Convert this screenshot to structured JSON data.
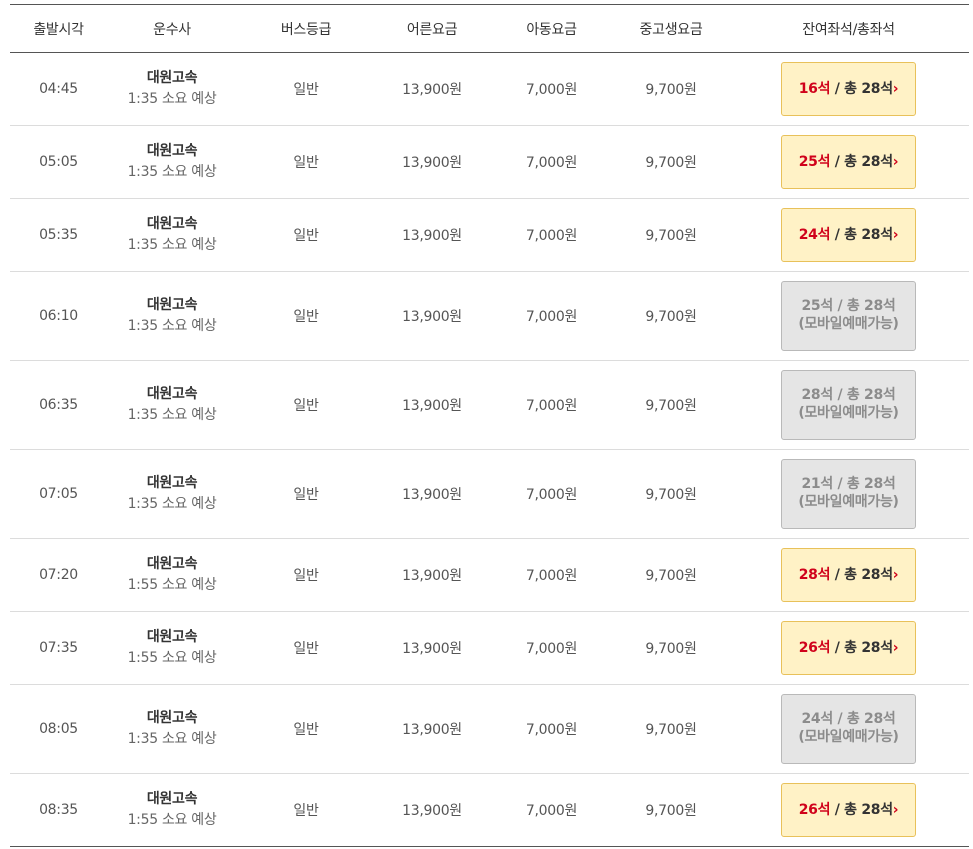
{
  "headers": [
    "출발시각",
    "운수사",
    "버스등급",
    "어른요금",
    "아동요금",
    "중고생요금",
    "잔여좌석/총좌석"
  ],
  "rows": [
    {
      "time": "04:45",
      "company": "대원고속",
      "duration": "1:35 소요 예상",
      "grade": "일반",
      "adult": "13,900원",
      "child": "7,000원",
      "student": "9,700원",
      "remaining": "16석",
      "total": " / 총 28석",
      "status": "available",
      "arrow": "›"
    },
    {
      "time": "05:05",
      "company": "대원고속",
      "duration": "1:35 소요 예상",
      "grade": "일반",
      "adult": "13,900원",
      "child": "7,000원",
      "student": "9,700원",
      "remaining": "25석",
      "total": " / 총 28석",
      "status": "available",
      "arrow": "›"
    },
    {
      "time": "05:35",
      "company": "대원고속",
      "duration": "1:35 소요 예상",
      "grade": "일반",
      "adult": "13,900원",
      "child": "7,000원",
      "student": "9,700원",
      "remaining": "24석",
      "total": " / 총 28석",
      "status": "available",
      "arrow": "›"
    },
    {
      "time": "06:10",
      "company": "대원고속",
      "duration": "1:35 소요 예상",
      "grade": "일반",
      "adult": "13,900원",
      "child": "7,000원",
      "student": "9,700원",
      "remaining": "25석",
      "total": " / 총 28석",
      "status": "mobile",
      "note": "(모바일예매가능)"
    },
    {
      "time": "06:35",
      "company": "대원고속",
      "duration": "1:35 소요 예상",
      "grade": "일반",
      "adult": "13,900원",
      "child": "7,000원",
      "student": "9,700원",
      "remaining": "28석",
      "total": " / 총 28석",
      "status": "mobile",
      "note": "(모바일예매가능)"
    },
    {
      "time": "07:05",
      "company": "대원고속",
      "duration": "1:35 소요 예상",
      "grade": "일반",
      "adult": "13,900원",
      "child": "7,000원",
      "student": "9,700원",
      "remaining": "21석",
      "total": " / 총 28석",
      "status": "mobile",
      "note": "(모바일예매가능)"
    },
    {
      "time": "07:20",
      "company": "대원고속",
      "duration": "1:55 소요 예상",
      "grade": "일반",
      "adult": "13,900원",
      "child": "7,000원",
      "student": "9,700원",
      "remaining": "28석",
      "total": " / 총 28석",
      "status": "available",
      "arrow": "›"
    },
    {
      "time": "07:35",
      "company": "대원고속",
      "duration": "1:55 소요 예상",
      "grade": "일반",
      "adult": "13,900원",
      "child": "7,000원",
      "student": "9,700원",
      "remaining": "26석",
      "total": " / 총 28석",
      "status": "available",
      "arrow": "›"
    },
    {
      "time": "08:05",
      "company": "대원고속",
      "duration": "1:35 소요 예상",
      "grade": "일반",
      "adult": "13,900원",
      "child": "7,000원",
      "student": "9,700원",
      "remaining": "24석",
      "total": " / 총 28석",
      "status": "mobile",
      "note": "(모바일예매가능)"
    },
    {
      "time": "08:35",
      "company": "대원고속",
      "duration": "1:55 소요 예상",
      "grade": "일반",
      "adult": "13,900원",
      "child": "7,000원",
      "student": "9,700원",
      "remaining": "26석",
      "total": " / 총 28석",
      "status": "available",
      "arrow": "›"
    }
  ],
  "colors": {
    "available_bg": "#fff2c6",
    "available_border": "#e8c15a",
    "remaining_text": "#d0021b",
    "mobile_bg": "#e5e5e5",
    "mobile_border": "#b9b9b9"
  }
}
